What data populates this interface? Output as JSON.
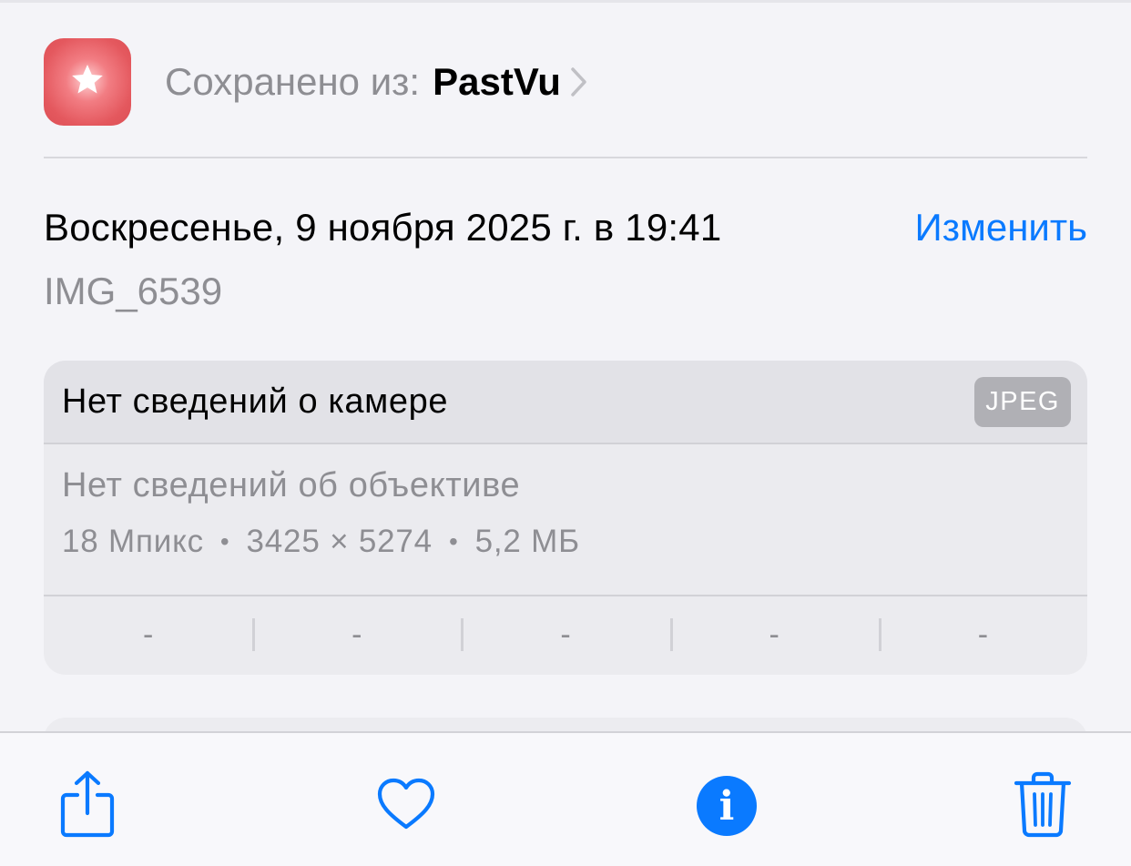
{
  "source": {
    "prefix": "Сохранено из:",
    "app_name": "PastVu",
    "app_icon": "star-icon",
    "app_icon_color": "#e4585e"
  },
  "date": {
    "text": "Воскресенье, 9 ноября 2025 г. в 19:41",
    "edit_label": "Изменить"
  },
  "filename": "IMG_6539",
  "camera_card": {
    "title": "Нет сведений о камере",
    "format_badge": "JPEG",
    "lens": "Нет сведений об объективе",
    "specs": [
      "18 Мпикс",
      "3425 × 5274",
      "5,2 МБ"
    ],
    "specs_separator": "•",
    "params": [
      "-",
      "-",
      "-",
      "-",
      "-"
    ]
  },
  "toolbar": {
    "share_icon": "share-icon",
    "favorite_icon": "heart-icon",
    "info_icon": "info-icon",
    "info_glyph": "i",
    "delete_icon": "trash-icon"
  },
  "colors": {
    "accent": "#0a7aff",
    "secondary_text": "#8e8e93",
    "background": "#f4f4f8"
  }
}
